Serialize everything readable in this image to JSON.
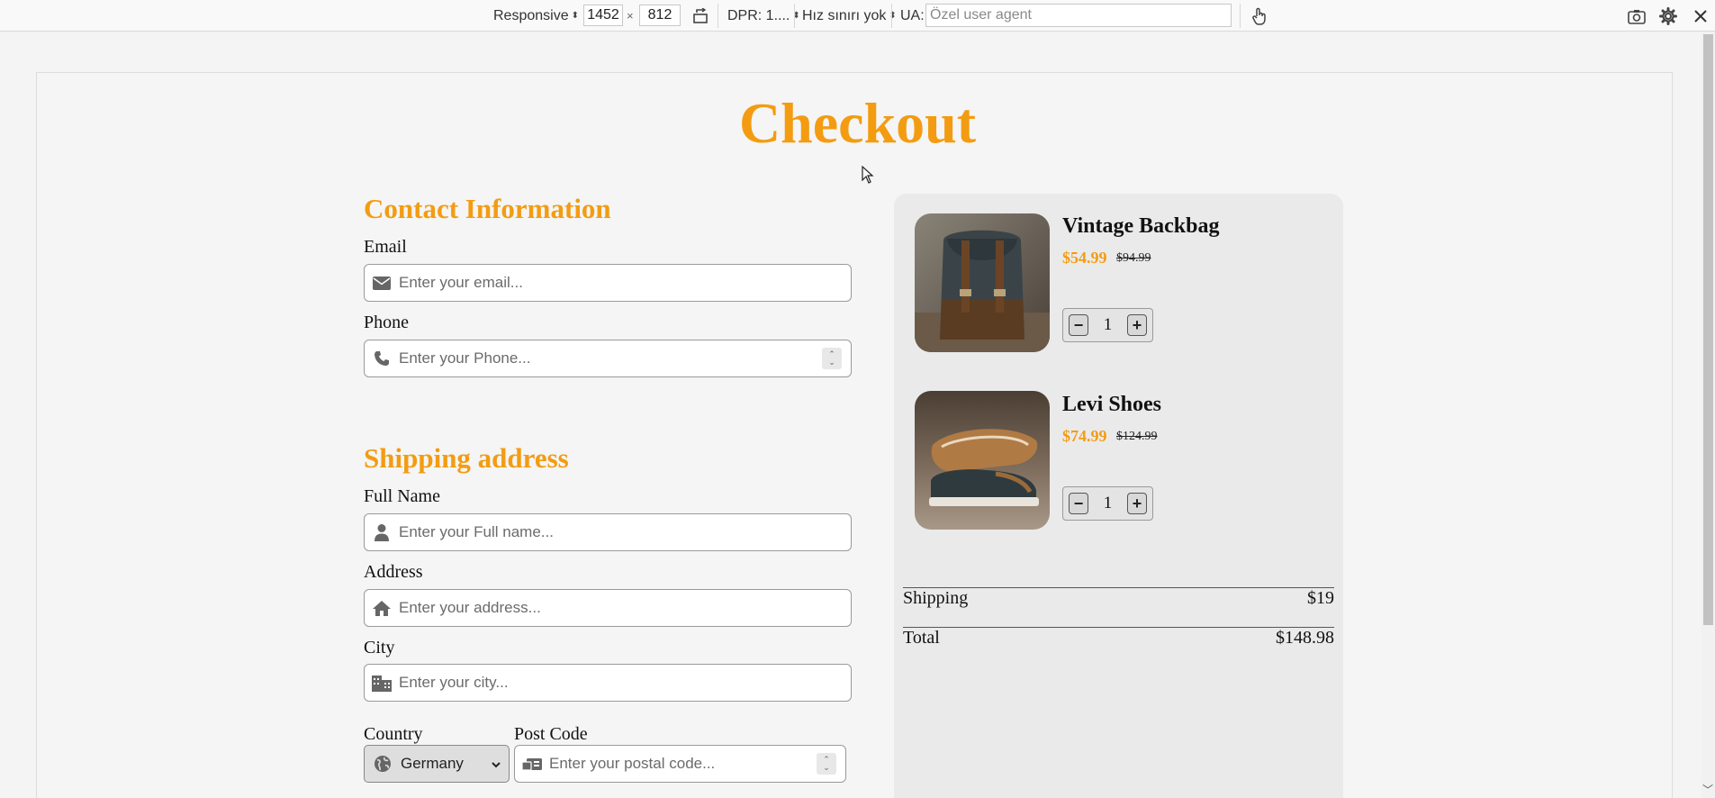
{
  "devtools": {
    "device": "Responsive",
    "width": "1452",
    "times": "×",
    "height": "812",
    "dpr": "DPR: 1....",
    "throttle": "Hız sınırı yok",
    "ua_label": "UA:",
    "ua_placeholder": "Özel user agent"
  },
  "page": {
    "title": "Checkout"
  },
  "contact": {
    "title": "Contact Information",
    "email_label": "Email",
    "email_placeholder": "Enter your email...",
    "phone_label": "Phone",
    "phone_placeholder": "Enter your Phone..."
  },
  "shipping": {
    "title": "Shipping address",
    "fullname_label": "Full Name",
    "fullname_placeholder": "Enter your Full name...",
    "address_label": "Address",
    "address_placeholder": "Enter your address...",
    "city_label": "City",
    "city_placeholder": "Enter your city...",
    "country_label": "Country",
    "country_value": "Germany",
    "postcode_label": "Post Code",
    "postcode_placeholder": "Enter your postal code..."
  },
  "cart": {
    "items": [
      {
        "name": "Vintage Backbag",
        "price": "$54.99",
        "old_price": "$94.99",
        "qty": "1",
        "minus": "−",
        "plus": "+"
      },
      {
        "name": "Levi Shoes",
        "price": "$74.99",
        "old_price": "$124.99",
        "qty": "1",
        "minus": "−",
        "plus": "+"
      }
    ],
    "shipping_label": "Shipping",
    "shipping_value": "$19",
    "total_label": "Total",
    "total_value": "$148.98"
  },
  "colors": {
    "accent": "#f39c12",
    "panel": "#eaeaea"
  },
  "icons": [
    "envelope-icon",
    "phone-icon",
    "user-icon",
    "home-icon",
    "city-icon",
    "globe-icon",
    "postal-icon",
    "screenshot-icon",
    "settings-icon",
    "close-icon",
    "touch-icon",
    "rotate-icon"
  ]
}
